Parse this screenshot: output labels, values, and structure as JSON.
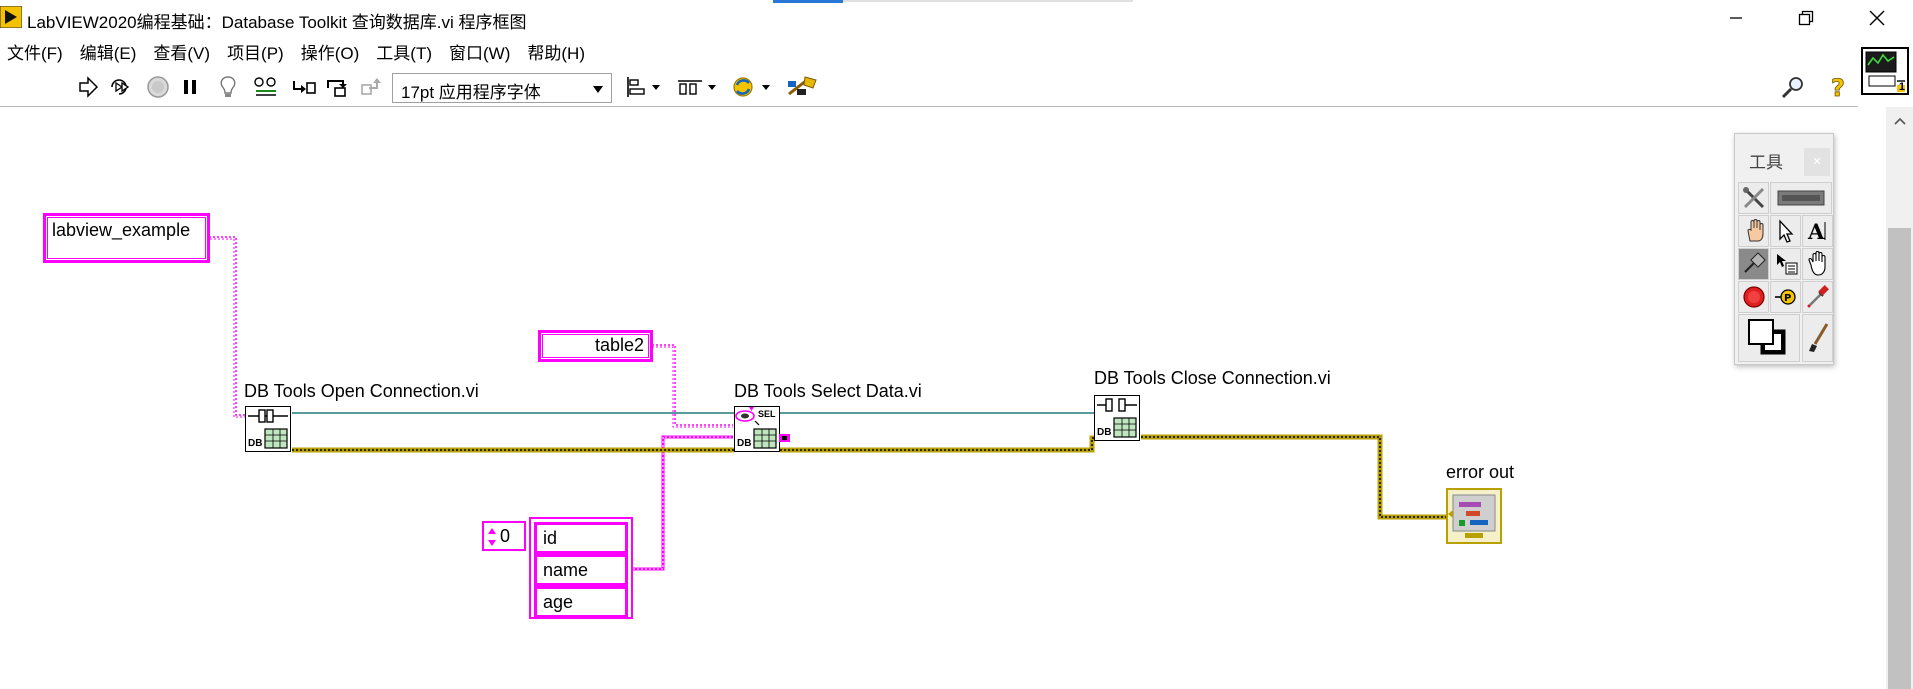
{
  "window": {
    "title": "LabVIEW2020编程基础：Database Toolkit 查询数据库.vi 程序框图"
  },
  "menu": {
    "items": [
      {
        "label": "文件(F)"
      },
      {
        "label": "编辑(E)"
      },
      {
        "label": "查看(V)"
      },
      {
        "label": "项目(P)"
      },
      {
        "label": "操作(O)"
      },
      {
        "label": "工具(T)"
      },
      {
        "label": "窗口(W)"
      },
      {
        "label": "帮助(H)"
      }
    ]
  },
  "toolbar": {
    "font_selector": "17pt 应用程序字体",
    "vi_icon_badge": "1",
    "icons": [
      "run-arrow-icon",
      "run-continuously-icon",
      "abort-icon",
      "pause-icon",
      "highlight-execution-icon",
      "retain-wire-values-icon",
      "step-into-icon",
      "step-over-icon",
      "step-out-icon",
      "align-objects-icon",
      "distribute-objects-icon",
      "reorder-icon",
      "cleanup-diagram-icon",
      "search-icon",
      "help-icon"
    ]
  },
  "diagram": {
    "constants": {
      "database_name": "labview_example",
      "table_name": "table2",
      "index_value": "0"
    },
    "columns": [
      "id",
      "name",
      "age"
    ],
    "nodes": {
      "open": "DB Tools Open Connection.vi",
      "select": "DB Tools Select Data.vi",
      "close": "DB Tools Close Connection.vi",
      "error_out": "error out"
    },
    "node_badges": {
      "db": "DB",
      "sel": "SEL"
    }
  },
  "palette": {
    "title": "工具",
    "close_glyph": "×"
  },
  "colors": {
    "string_wire": "#ff00ff",
    "reference_wire": "#247b7b",
    "error_wire": "#b8a000"
  }
}
